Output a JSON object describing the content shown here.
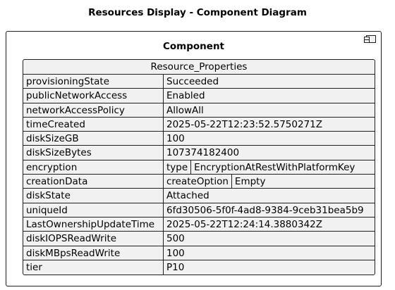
{
  "diagram_title": "Resources Display - Component Diagram",
  "component": {
    "label": "Component",
    "table_header": "Resource_Properties",
    "rows": [
      {
        "key": "provisioningState",
        "value": "Succeeded"
      },
      {
        "key": "publicNetworkAccess",
        "value": "Enabled"
      },
      {
        "key": "networkAccessPolicy",
        "value": "AllowAll"
      },
      {
        "key": "timeCreated",
        "value": "2025-05-22T12:23:52.5750271Z"
      },
      {
        "key": "diskSizeGB",
        "value": "100"
      },
      {
        "key": "diskSizeBytes",
        "value": "107374182400"
      },
      {
        "key": "encryption",
        "sub_key": "type",
        "sub_value": "EncryptionAtRestWithPlatformKey"
      },
      {
        "key": "creationData",
        "sub_key": "createOption",
        "sub_value": "Empty"
      },
      {
        "key": "diskState",
        "value": "Attached"
      },
      {
        "key": "uniqueId",
        "value": "6fd30506-5f0f-4ad8-9384-9ceb31bea5b9"
      },
      {
        "key": "LastOwnershipUpdateTime",
        "value": "2025-05-22T12:24:14.3880342Z"
      },
      {
        "key": "diskIOPSReadWrite",
        "value": "500"
      },
      {
        "key": "diskMBpsReadWrite",
        "value": "100"
      },
      {
        "key": "tier",
        "value": "P10"
      }
    ]
  }
}
